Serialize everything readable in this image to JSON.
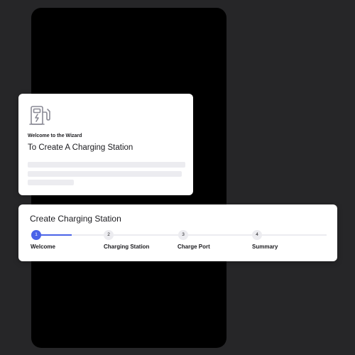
{
  "colors": {
    "background": "#262628",
    "phone": "#000000",
    "card": "#ffffff",
    "accent": "#4a63e8",
    "inactive_step": "#ececf0",
    "skeleton": "#ececf0"
  },
  "welcome_card": {
    "icon": "charging-station-icon",
    "eyebrow": "Welcome to the Wizard",
    "title": "To Create A Charging Station"
  },
  "wizard": {
    "title": "Create Charging Station",
    "progress": 0.25,
    "active_step": 1,
    "steps": [
      {
        "number": "1",
        "label": "Welcome"
      },
      {
        "number": "2",
        "label": "Charging Station"
      },
      {
        "number": "3",
        "label": "Charge Port"
      },
      {
        "number": "4",
        "label": "Summary"
      }
    ]
  }
}
